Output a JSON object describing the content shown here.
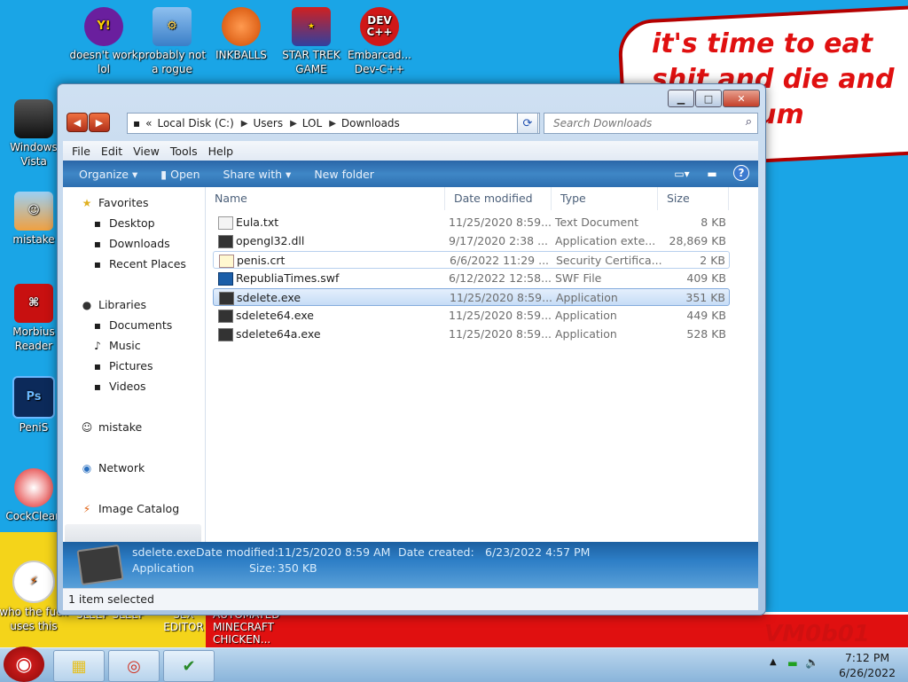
{
  "desktop": {
    "speech_text": "it's time to eat shit and die and chew gum",
    "watermark": "VM0b01",
    "bottom_texts": [
      "who the fuck uses this",
      "SLEEP SLEEP",
      "SEX EDITOR",
      "AUTOMATED MINECRAFT CHICKEN..."
    ],
    "icons": [
      {
        "label": "doesn't work lol",
        "icon": "yahoo-icon"
      },
      {
        "label": "probably not a rogue",
        "icon": "system-icon"
      },
      {
        "label": "INKBALLS",
        "icon": "inkball-icon"
      },
      {
        "label": "STAR TREK GAME",
        "icon": "star-trek-icon"
      },
      {
        "label": "Embarcad... Dev-C++",
        "icon": "devcpp-icon"
      },
      {
        "label": "Windows Vista",
        "icon": "recycle-bin-icon"
      },
      {
        "label": "mistake",
        "icon": "user-icon"
      },
      {
        "label": "Morbius Reader",
        "icon": "pdf-icon"
      },
      {
        "label": "PeniS",
        "icon": "photoshop-icon"
      },
      {
        "label": "CockClean",
        "icon": "ccleaner-icon"
      }
    ],
    "devcpp_badge": "DEV C++",
    "ps_badge": "Ps"
  },
  "window": {
    "address": {
      "prefix": "«",
      "crumbs": [
        "Local Disk (C:)",
        "Users",
        "LOL",
        "Downloads"
      ]
    },
    "search_placeholder": "Search Downloads",
    "menu": [
      "File",
      "Edit",
      "View",
      "Tools",
      "Help"
    ],
    "commands": {
      "organize": "Organize ▾",
      "open": "Open",
      "share": "Share with ▾",
      "new_folder": "New folder"
    },
    "nav": {
      "favorites": "Favorites",
      "desktop": "Desktop",
      "downloads": "Downloads",
      "recent": "Recent Places",
      "libraries": "Libraries",
      "documents": "Documents",
      "music": "Music",
      "pictures": "Pictures",
      "videos": "Videos",
      "mistake": "mistake",
      "network": "Network",
      "image_catalog": "Image Catalog"
    },
    "columns": {
      "name": "Name",
      "date": "Date modified",
      "type": "Type",
      "size": "Size"
    },
    "files": [
      {
        "name": "Eula.txt",
        "date": "11/25/2020 8:59...",
        "type": "Text Document",
        "size": "8 KB"
      },
      {
        "name": "opengl32.dll",
        "date": "9/17/2020 2:38 ...",
        "type": "Application exte...",
        "size": "28,869 KB"
      },
      {
        "name": "penis.crt",
        "date": "6/6/2022 11:29 ...",
        "type": "Security Certifica...",
        "size": "2 KB"
      },
      {
        "name": "RepubliaTimes.swf",
        "date": "6/12/2022 12:58...",
        "type": "SWF File",
        "size": "409 KB"
      },
      {
        "name": "sdelete.exe",
        "date": "11/25/2020 8:59...",
        "type": "Application",
        "size": "351 KB"
      },
      {
        "name": "sdelete64.exe",
        "date": "11/25/2020 8:59...",
        "type": "Application",
        "size": "449 KB"
      },
      {
        "name": "sdelete64a.exe",
        "date": "11/25/2020 8:59...",
        "type": "Application",
        "size": "528 KB"
      }
    ],
    "details": {
      "name": "sdelete.exe",
      "modified_label": "Date modified:",
      "modified": "11/25/2020 8:59 AM",
      "created_label": "Date created:",
      "created": "6/23/2022 4:57 PM",
      "type": "Application",
      "size_label": "Size:",
      "size": "350 KB"
    },
    "status": "1 item selected"
  },
  "taskbar": {
    "time": "7:12 PM",
    "date": "6/26/2022"
  }
}
